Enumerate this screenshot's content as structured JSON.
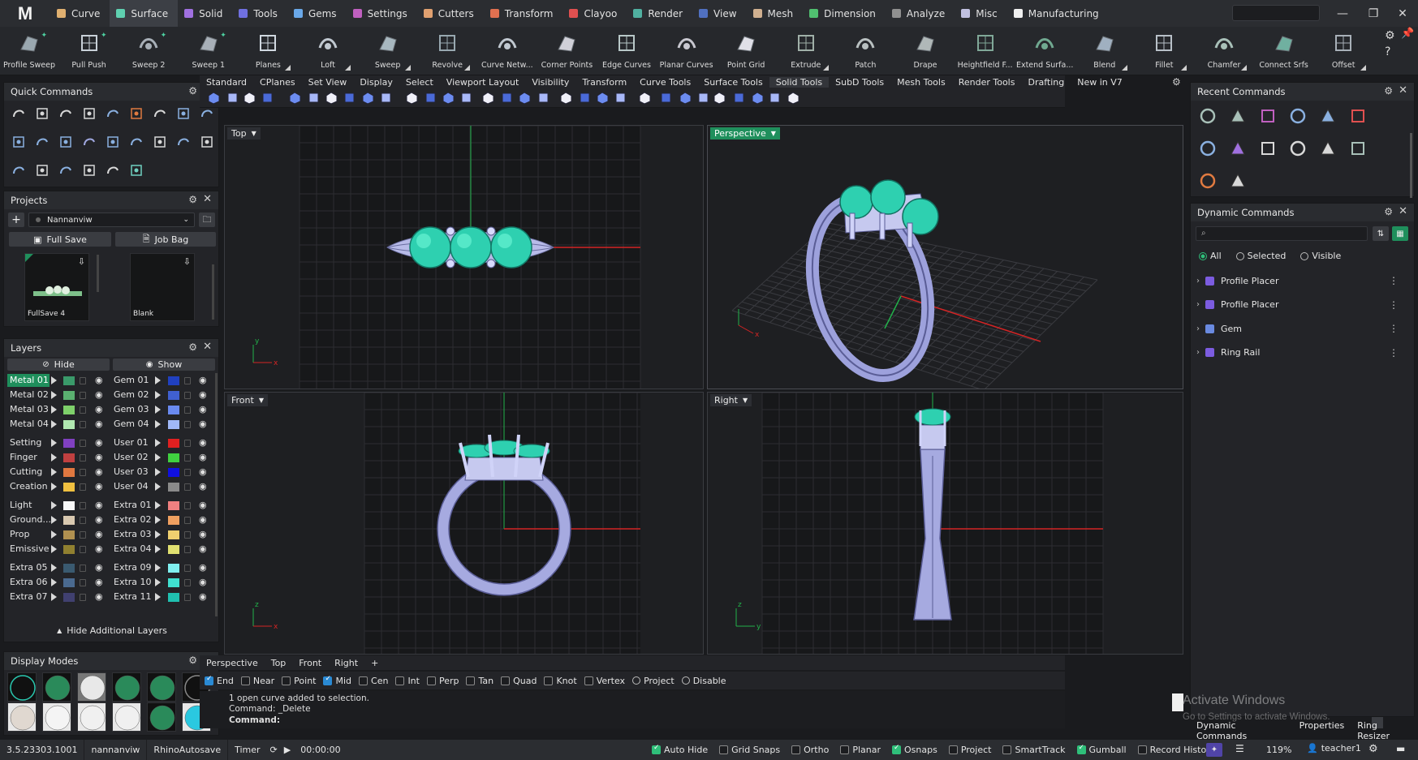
{
  "app": {
    "logo": "M"
  },
  "menu": [
    {
      "label": "Curve",
      "color": "#e0b070"
    },
    {
      "label": "Surface",
      "color": "#5fd0b0",
      "active": true
    },
    {
      "label": "Solid",
      "color": "#a070e0"
    },
    {
      "label": "Tools",
      "color": "#7070e0"
    },
    {
      "label": "Gems",
      "color": "#6aa8e8"
    },
    {
      "label": "Settings",
      "color": "#c060c0"
    },
    {
      "label": "Cutters",
      "color": "#e0a070"
    },
    {
      "label": "Transform",
      "color": "#e07050"
    },
    {
      "label": "Clayoo",
      "color": "#e05050"
    },
    {
      "label": "Render",
      "color": "#50b0a0"
    },
    {
      "label": "View",
      "color": "#5070c0"
    },
    {
      "label": "Mesh",
      "color": "#d0b090"
    },
    {
      "label": "Dimension",
      "color": "#50c070"
    },
    {
      "label": "Analyze",
      "color": "#909090"
    },
    {
      "label": "Misc",
      "color": "#c0c0e0"
    },
    {
      "label": "Manufacturing",
      "color": "#f0f0f0"
    }
  ],
  "search": {
    "placeholder": "",
    "icon": "search-icon"
  },
  "toolbar": [
    {
      "label": "Profile Sweep",
      "icon": "profile-sweep-icon"
    },
    {
      "label": "Pull Push",
      "icon": "pull-push-icon"
    },
    {
      "label": "Sweep 2",
      "icon": "sweep2-icon"
    },
    {
      "label": "Sweep 1",
      "icon": "sweep1-icon"
    },
    {
      "label": "Planes",
      "icon": "planes-icon"
    },
    {
      "label": "Loft",
      "icon": "loft-icon"
    },
    {
      "label": "Sweep",
      "icon": "sweep-icon"
    },
    {
      "label": "Revolve",
      "icon": "revolve-icon"
    },
    {
      "label": "Curve Netw...",
      "icon": "curve-network-icon"
    },
    {
      "label": "Corner Points",
      "icon": "corner-points-icon"
    },
    {
      "label": "Edge Curves",
      "icon": "edge-curves-icon"
    },
    {
      "label": "Planar Curves",
      "icon": "planar-curves-icon"
    },
    {
      "label": "Point Grid",
      "icon": "point-grid-icon"
    },
    {
      "label": "Extrude",
      "icon": "extrude-icon"
    },
    {
      "label": "Patch",
      "icon": "patch-icon"
    },
    {
      "label": "Drape",
      "icon": "drape-icon"
    },
    {
      "label": "Heightfield F...",
      "icon": "heightfield-icon"
    },
    {
      "label": "Extend Surfa...",
      "icon": "extend-surface-icon"
    },
    {
      "label": "Blend",
      "icon": "blend-icon"
    },
    {
      "label": "Fillet",
      "icon": "fillet-icon"
    },
    {
      "label": "Chamfer",
      "icon": "chamfer-icon"
    },
    {
      "label": "Connect Srfs",
      "icon": "connect-surfaces-icon"
    },
    {
      "label": "Offset",
      "icon": "offset-icon"
    }
  ],
  "panels": {
    "quick_commands": {
      "title": "Quick Commands"
    },
    "projects": {
      "title": "Projects",
      "project_name": "Nannanviw",
      "full_save": "Full Save",
      "job_bag": "Job Bag",
      "thumb1": "FullSave 4",
      "thumb2": "Blank"
    },
    "layers": {
      "title": "Layers",
      "hide": "Hide",
      "show": "Show",
      "left": [
        {
          "name": "Metal 01",
          "color": "#3a9a6a",
          "selected": true
        },
        {
          "name": "Metal 02",
          "color": "#5ab070"
        },
        {
          "name": "Metal 03",
          "color": "#7ed06a"
        },
        {
          "name": "Metal 04",
          "color": "#b0e8b0"
        },
        {
          "name": "Setting",
          "color": "#8040c0"
        },
        {
          "name": "Finger",
          "color": "#c04040"
        },
        {
          "name": "Cutting",
          "color": "#e07840"
        },
        {
          "name": "Creation",
          "color": "#f0c040"
        },
        {
          "name": "Light",
          "color": "#f8f8f8"
        },
        {
          "name": "Ground...",
          "color": "#d8c8b0"
        },
        {
          "name": "Prop",
          "color": "#b09050"
        },
        {
          "name": "Emissive",
          "color": "#908030"
        },
        {
          "name": "Extra 05",
          "color": "#3a5a70"
        },
        {
          "name": "Extra 06",
          "color": "#4a6a90"
        },
        {
          "name": "Extra 07",
          "color": "#404070"
        }
      ],
      "right": [
        {
          "name": "Gem 01",
          "color": "#2040c0"
        },
        {
          "name": "Gem 02",
          "color": "#4060d0"
        },
        {
          "name": "Gem 03",
          "color": "#6a8af0"
        },
        {
          "name": "Gem 04",
          "color": "#a0b8f8"
        },
        {
          "name": "User 01",
          "color": "#e02020"
        },
        {
          "name": "User 02",
          "color": "#40d040"
        },
        {
          "name": "User 03",
          "color": "#1010e0"
        },
        {
          "name": "User 04",
          "color": "#8a8a8a"
        },
        {
          "name": "Extra 01",
          "color": "#f08080"
        },
        {
          "name": "Extra 02",
          "color": "#f0a060"
        },
        {
          "name": "Extra 03",
          "color": "#f0d070"
        },
        {
          "name": "Extra 04",
          "color": "#e0e070"
        },
        {
          "name": "Extra 09",
          "color": "#80f0f0"
        },
        {
          "name": "Extra 10",
          "color": "#40e0d0"
        },
        {
          "name": "Extra 11",
          "color": "#20c0b0"
        }
      ],
      "hide_additional": "Hide Additional Layers"
    },
    "display_modes": {
      "title": "Display Modes"
    },
    "recent_commands": {
      "title": "Recent Commands"
    },
    "dynamic_commands": {
      "title": "Dynamic Commands",
      "filter_all": "All",
      "filter_selected": "Selected",
      "filter_visible": "Visible",
      "items": [
        "Profile Placer",
        "Profile Placer",
        "Gem",
        "Ring Rail"
      ]
    }
  },
  "view_tabs": [
    "Standard",
    "CPlanes",
    "Set View",
    "Display",
    "Select",
    "Viewport Layout",
    "Visibility",
    "Transform",
    "Curve Tools",
    "Surface Tools",
    "Solid Tools",
    "SubD Tools",
    "Mesh Tools",
    "Render Tools",
    "Drafting",
    "New in V7"
  ],
  "active_view_tab": "Solid Tools",
  "viewports": {
    "top": "Top",
    "perspective": "Perspective",
    "front": "Front",
    "right": "Right"
  },
  "bottom_tabs": [
    "Perspective",
    "Top",
    "Front",
    "Right"
  ],
  "osnaps": [
    {
      "label": "End",
      "on": true
    },
    {
      "label": "Near",
      "on": false
    },
    {
      "label": "Point",
      "on": false
    },
    {
      "label": "Mid",
      "on": true
    },
    {
      "label": "Cen",
      "on": false
    },
    {
      "label": "Int",
      "on": false
    },
    {
      "label": "Perp",
      "on": false
    },
    {
      "label": "Tan",
      "on": false
    },
    {
      "label": "Quad",
      "on": false
    },
    {
      "label": "Knot",
      "on": false
    },
    {
      "label": "Vertex",
      "on": false
    },
    {
      "label": "Project",
      "radio": true
    },
    {
      "label": "Disable",
      "radio": true
    }
  ],
  "command_history": [
    "1 open curve added to selection.",
    "Command: _Delete"
  ],
  "command_prompt": "Command:",
  "watermark": {
    "line1": "Activate Windows",
    "line2": "Go to Settings to activate Windows."
  },
  "right_bottom_tabs": [
    "Dynamic Commands",
    "Properties",
    "Ring Resizer"
  ],
  "status": {
    "version": "3.5.23303.1001",
    "user_file": "nannanviw",
    "autosave": "RhinoAutosave",
    "timer_label": "Timer",
    "timer": "00:00:00",
    "toggles": [
      {
        "label": "Auto Hide",
        "on": true
      },
      {
        "label": "Grid Snaps",
        "on": false
      },
      {
        "label": "Ortho",
        "on": false
      },
      {
        "label": "Planar",
        "on": false
      },
      {
        "label": "Osnaps",
        "on": true
      },
      {
        "label": "Project",
        "on": false
      },
      {
        "label": "SmartTrack",
        "on": false
      },
      {
        "label": "Gumball",
        "on": true
      },
      {
        "label": "Record History",
        "on": false
      }
    ],
    "zoom": "119%",
    "user": "teacher1"
  }
}
